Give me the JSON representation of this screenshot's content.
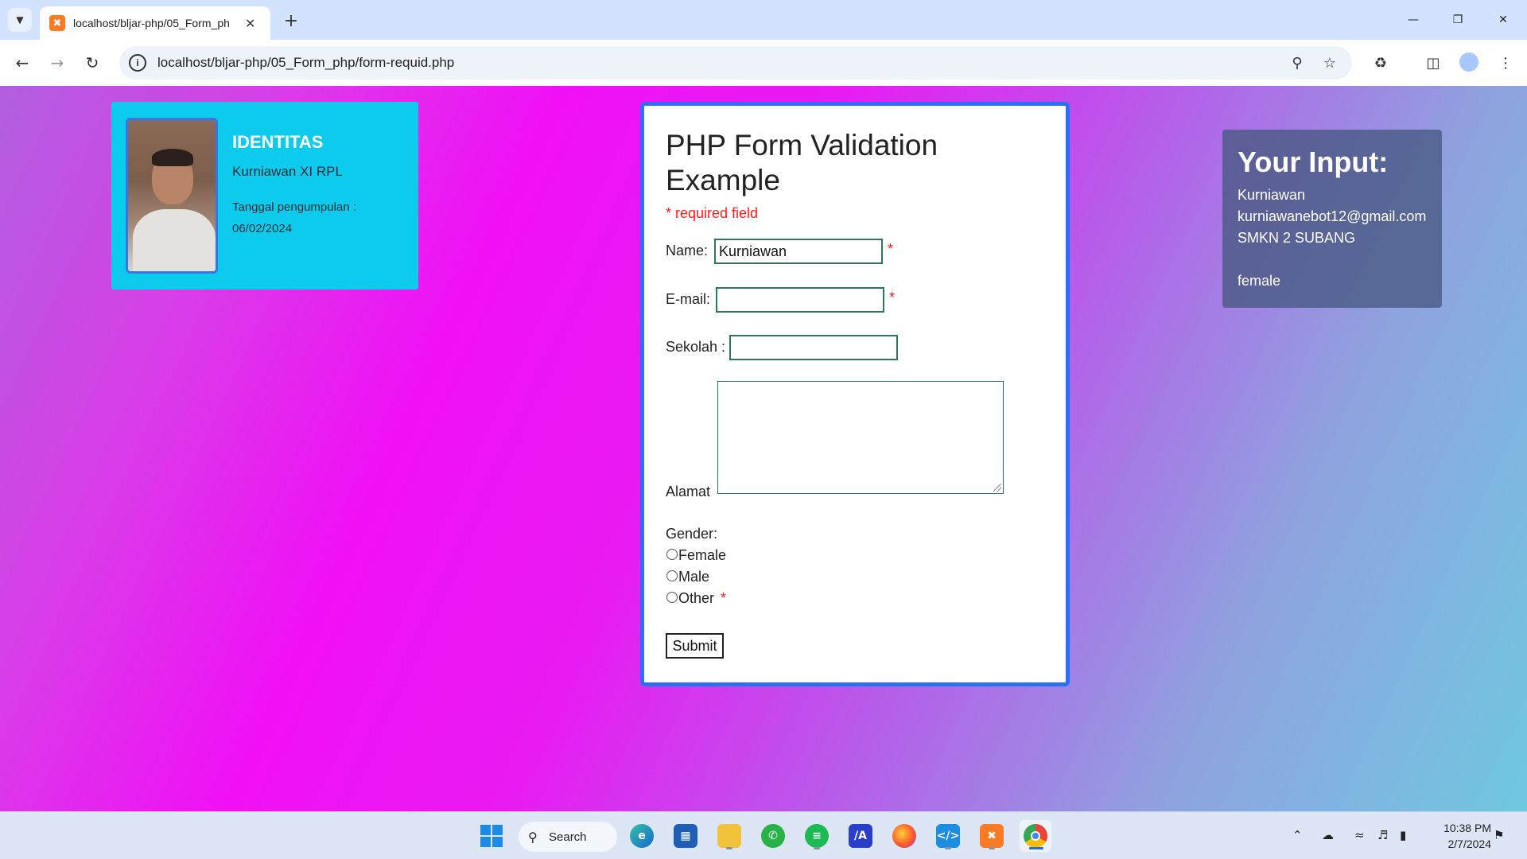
{
  "browser": {
    "tab_title": "localhost/bljar-php/05_Form_ph",
    "tab_favicon": "xampp-icon",
    "url": "localhost/bljar-php/05_Form_php/form-requid.php",
    "icons": [
      "tab-list-icon",
      "close-tab-icon",
      "new-tab-icon",
      "minimize-icon",
      "restore-icon",
      "close-window-icon",
      "back-icon",
      "forward-icon",
      "reload-icon",
      "site-info-icon",
      "zoom-icon",
      "bookmark-star-icon",
      "extensions-icon",
      "side-panel-icon",
      "profile-avatar",
      "menu-icon"
    ]
  },
  "identitas": {
    "title": "IDENTITAS",
    "name": "Kurniawan XI RPL",
    "date_label": "Tanggal pengumpulan :",
    "date": "06/02/2024"
  },
  "form": {
    "title": "PHP Form Validation Example",
    "required_note": "* required field",
    "name_label": "Name:",
    "name_value": "Kurniawan",
    "email_label": "E-mail:",
    "email_value": "",
    "sekolah_label": "Sekolah :",
    "sekolah_value": "",
    "alamat_label": "Alamat",
    "gender_label": "Gender:",
    "gender_options": [
      "Female",
      "Male",
      "Other"
    ],
    "required_star": "*",
    "submit_label": "Submit"
  },
  "output": {
    "title": "Your Input:",
    "name": "Kurniawan",
    "email": "kurniawanebot12@gmail.com",
    "school": "SMKN 2 SUBANG",
    "address": "",
    "gender": "female"
  },
  "taskbar": {
    "search_label": "Search",
    "time": "10:38 PM",
    "date": "2/7/2024",
    "apps": [
      "windows-start-icon",
      "edge-icon",
      "microsoft-store-icon",
      "file-explorer-icon",
      "whatsapp-icon",
      "spotify-icon",
      "editor-app-icon",
      "firefox-icon",
      "vscode-icon",
      "xampp-icon",
      "chrome-icon"
    ]
  },
  "colors": {
    "identitas_bg": "#0ccbed",
    "form_border": "#2a70f5",
    "required_red": "#ff1a1a",
    "output_bg": "#4f5d82"
  }
}
